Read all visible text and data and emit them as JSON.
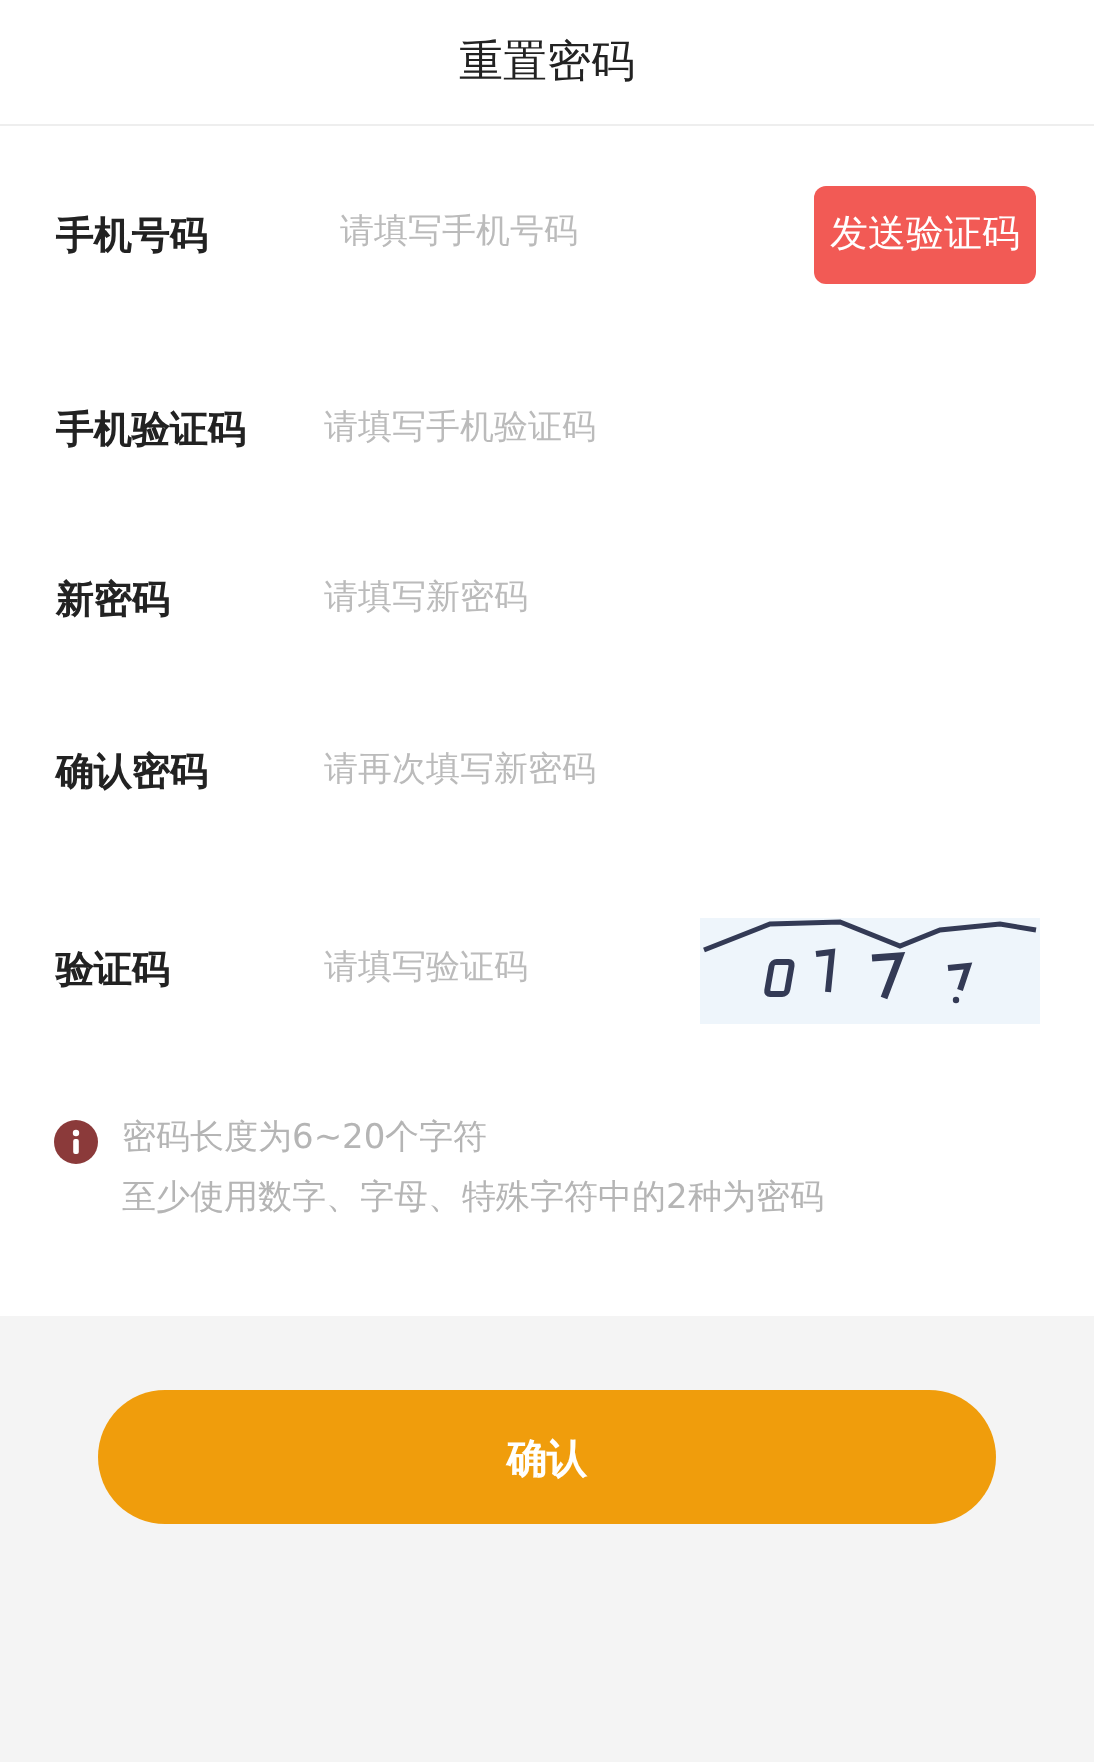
{
  "header": {
    "title": "重置密码"
  },
  "fields": [
    {
      "kind": "button",
      "label": "手机号码",
      "placeholder": "请填写手机号码",
      "button": "发送验证码"
    },
    {
      "kind": "plain",
      "label": "手机验证码",
      "placeholder": "请填写手机验证码"
    },
    {
      "kind": "plain",
      "label": "新密码",
      "placeholder": "请填写新密码"
    },
    {
      "kind": "plain",
      "label": "确认密码",
      "placeholder": "请再次填写新密码"
    },
    {
      "kind": "captcha",
      "label": "验证码",
      "placeholder": "请填写验证码"
    }
  ],
  "hint": {
    "lines": [
      "密码长度为6~20个字符",
      "至少使用数字、字母、特殊字符中的2种为密码"
    ]
  },
  "confirm_button": "确认"
}
